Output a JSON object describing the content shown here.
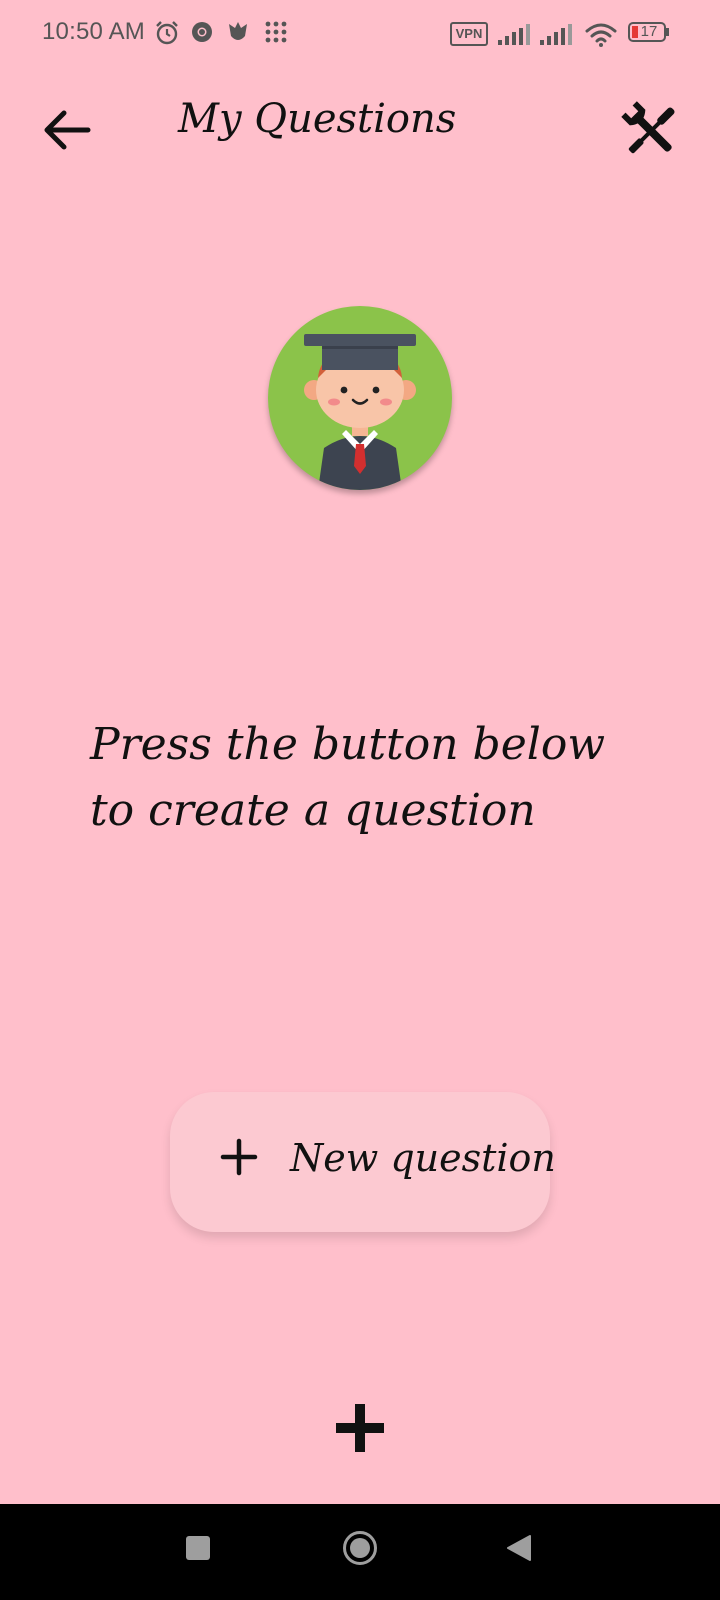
{
  "status_bar": {
    "time": "10:50 AM",
    "vpn": "VPN",
    "battery": "17",
    "icons": [
      "alarm-icon",
      "chrome-icon",
      "tulip-icon",
      "app-grid-icon",
      "signal-icon",
      "signal-icon",
      "wifi-icon",
      "battery-icon"
    ]
  },
  "app_bar": {
    "title": "My Questions",
    "back_icon": "arrow-left-icon",
    "tools_icon": "tools-icon"
  },
  "avatar": {
    "icon": "graduate-avatar-icon",
    "background_color": "#8bc34a"
  },
  "empty_state": {
    "message": "Press the button below to create a question"
  },
  "new_question_button": {
    "icon": "plus-icon",
    "label": "New question"
  },
  "bottom_action": {
    "icon": "plus-bold-icon"
  },
  "nav_bar": {
    "icons": [
      "recents-square-icon",
      "home-circle-icon",
      "back-triangle-icon"
    ]
  },
  "colors": {
    "background": "#ffbfcb",
    "button_background": "#fcc9d1",
    "text": "#111111",
    "nav_background": "#000000"
  }
}
